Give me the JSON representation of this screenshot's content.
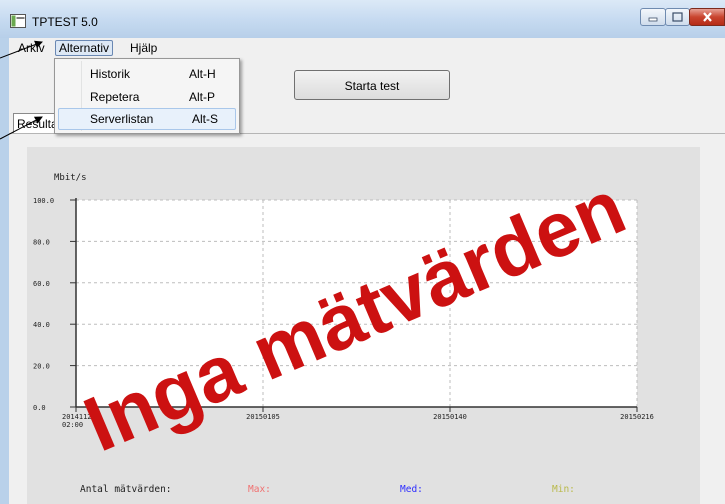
{
  "window": {
    "title": "TPTEST 5.0"
  },
  "menubar": {
    "items": [
      "Arkiv",
      "Alternativ",
      "Hjälp"
    ]
  },
  "dropdown": {
    "items": [
      {
        "label": "Historik",
        "shortcut": "Alt-H"
      },
      {
        "label": "Repetera",
        "shortcut": "Alt-P"
      },
      {
        "label": "Serverlistan",
        "shortcut": "Alt-S"
      }
    ]
  },
  "toolbar": {
    "start_label": "Starta test"
  },
  "tab": {
    "label": "Resultat"
  },
  "chart_data": {
    "type": "line",
    "ylabel": "Mbit/s",
    "ylim": [
      0,
      100
    ],
    "y_ticks": [
      "100.0",
      "80.0",
      "60.0",
      "40.0",
      "20.0",
      "0.0"
    ],
    "x_ticks": [
      "20141126\n02:00",
      "20150105",
      "20150140",
      "20150216"
    ],
    "series": [],
    "grid": true
  },
  "stats": {
    "count_label": "Antal mätvärden:",
    "max_label": "Max:",
    "med_label": "Med:",
    "min_label": "Min:",
    "max_color": "#f07070",
    "med_color": "#2c2cff",
    "min_color": "#b9b94a"
  },
  "watermark": {
    "text": "Inga mätvärden",
    "color": "#cc1111"
  }
}
